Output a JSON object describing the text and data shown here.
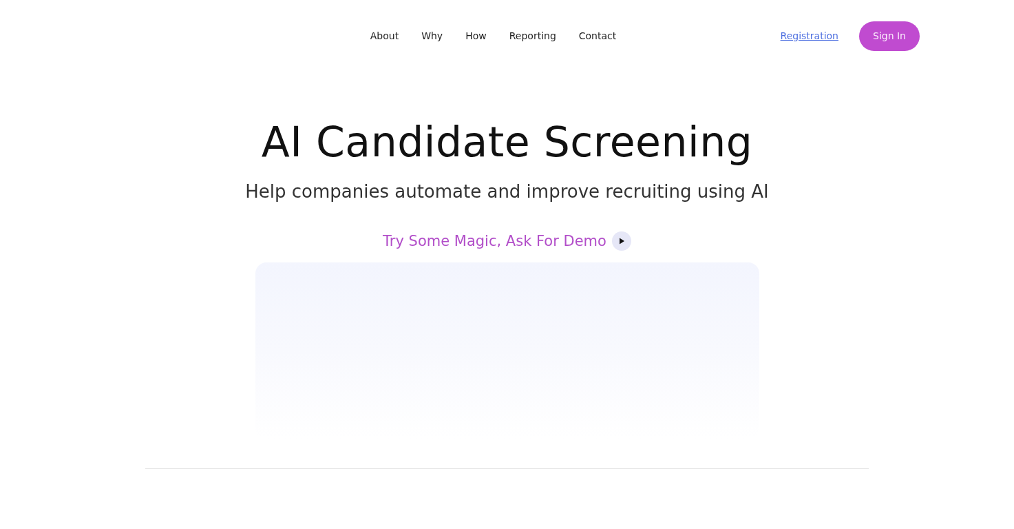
{
  "nav": {
    "links": [
      "About",
      "Why",
      "How",
      "Reporting",
      "Contact"
    ]
  },
  "header_actions": {
    "registration_link": "Registration",
    "sign_in_button": "Sign In"
  },
  "hero": {
    "title": "AI Candidate Screening",
    "subtitle": "Help companies automate and improve recruiting using AI",
    "demo_link": "Try Some Magic, Ask For Demo"
  }
}
